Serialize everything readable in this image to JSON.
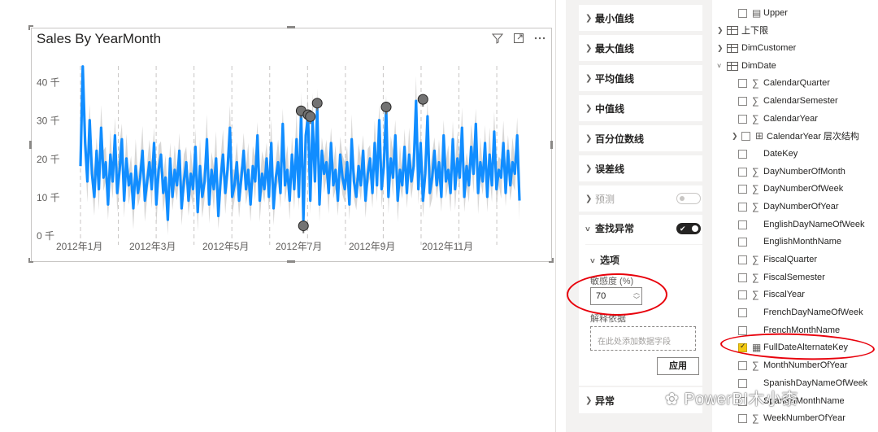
{
  "visual": {
    "title": "Sales By YearMonth",
    "header_icons": [
      "filter-icon",
      "focus-mode-icon",
      "more-options-icon"
    ]
  },
  "chart_data": {
    "type": "line",
    "title": "Sales By YearMonth",
    "xlabel": "",
    "ylabel": "",
    "y_ticks": [
      "0 千",
      "10 千",
      "20 千",
      "30 千",
      "40 千"
    ],
    "x_ticks": [
      "2012年1月",
      "2012年3月",
      "2012年5月",
      "2012年7月",
      "2012年9月",
      "2012年11月"
    ],
    "ylim": [
      0,
      45000
    ],
    "series_color": "#118dff",
    "band_color": "#c8c6c4",
    "anomaly_color": "#737373",
    "values": [
      18000,
      44000,
      24000,
      14000,
      30000,
      16000,
      10000,
      22000,
      12000,
      28000,
      15000,
      19000,
      8000,
      21000,
      14000,
      26000,
      11000,
      17000,
      25000,
      9000,
      20000,
      13000,
      16000,
      7000,
      18000,
      11000,
      15000,
      22000,
      9000,
      14000,
      19000,
      12000,
      24000,
      8000,
      17000,
      21000,
      11000,
      15000,
      4000,
      20000,
      10000,
      17000,
      13000,
      22000,
      7000,
      14000,
      19000,
      9000,
      16000,
      12000,
      23000,
      6000,
      18000,
      10000,
      14000,
      25000,
      8000,
      17000,
      12000,
      20000,
      5000,
      15000,
      21000,
      11000,
      17000,
      28000,
      10000,
      13000,
      19000,
      9000,
      15000,
      22000,
      12000,
      17000,
      8000,
      18000,
      14000,
      26000,
      9000,
      16000,
      12000,
      20000,
      10000,
      24000,
      7000,
      15000,
      19000,
      11000,
      29000,
      13000,
      17000,
      9000,
      21000,
      12000,
      25000,
      10000,
      32000,
      4000,
      26000,
      31000,
      9000,
      30000,
      14000,
      33000,
      8000,
      22000,
      16000,
      19000,
      11000,
      24000,
      13000,
      17000,
      9000,
      21000,
      15000,
      12000,
      19000,
      8000,
      25000,
      14000,
      10000,
      18000,
      13000,
      22000,
      9000,
      16000,
      20000,
      11000,
      24000,
      13000,
      30000,
      12000,
      18000,
      33000,
      10000,
      20000,
      15000,
      26000,
      9000,
      17000,
      13000,
      23000,
      11000,
      21000,
      14000,
      18000,
      35000,
      12000,
      24000,
      9000,
      16000,
      31000,
      11000,
      15000,
      22000,
      13000,
      19000,
      10000,
      26000,
      14000,
      17000,
      11000,
      25000,
      12000,
      20000,
      15000,
      28000,
      10000,
      18000,
      13000,
      23000,
      16000,
      29000,
      11000,
      19000,
      14000,
      24000,
      10000,
      21000,
      13000,
      27000,
      12000,
      17000,
      15000,
      24000,
      11000,
      22000,
      13000,
      19000,
      16000,
      26000,
      9000
    ],
    "anomalies": [
      {
        "index": 96,
        "value": 32000
      },
      {
        "index": 97,
        "value": 2000
      },
      {
        "index": 99,
        "value": 31000
      },
      {
        "index": 100,
        "value": 30500
      },
      {
        "index": 103,
        "value": 34000
      },
      {
        "index": 133,
        "value": 33000
      },
      {
        "index": 149,
        "value": 35000
      }
    ]
  },
  "format_pane": {
    "cards": [
      {
        "label": "最小值线"
      },
      {
        "label": "最大值线"
      },
      {
        "label": "平均值线"
      },
      {
        "label": "中值线"
      },
      {
        "label": "百分位数线"
      },
      {
        "label": "误差线"
      }
    ],
    "forecast": {
      "label": "预测",
      "toggle": "off"
    },
    "find_anomalies": {
      "label": "查找异常",
      "toggle": "on",
      "options": {
        "header": "选项",
        "sensitivity_label": "敏感度 (%)",
        "sensitivity_value": "70",
        "explain_label": "解释依据",
        "dropzone_placeholder": "在此处添加数据字段",
        "apply_label": "应用"
      }
    },
    "anomaly_card": {
      "label": "异常"
    },
    "annotation_color": "#e8000b"
  },
  "fields": {
    "items": [
      {
        "label": "Upper",
        "kind": "field",
        "checked": false
      },
      {
        "label": "上下限",
        "kind": "table"
      },
      {
        "label": "DimCustomer",
        "kind": "table"
      },
      {
        "label": "DimDate",
        "kind": "table-open"
      },
      {
        "label": "CalendarQuarter",
        "kind": "measure",
        "checked": false
      },
      {
        "label": "CalendarSemester",
        "kind": "measure",
        "checked": false
      },
      {
        "label": "CalendarYear",
        "kind": "measure",
        "checked": false
      },
      {
        "label": "CalendarYear 层次结构",
        "kind": "hierarchy",
        "checked": false
      },
      {
        "label": "DateKey",
        "kind": "field",
        "checked": false
      },
      {
        "label": "DayNumberOfMonth",
        "kind": "measure",
        "checked": false
      },
      {
        "label": "DayNumberOfWeek",
        "kind": "measure",
        "checked": false
      },
      {
        "label": "DayNumberOfYear",
        "kind": "measure",
        "checked": false
      },
      {
        "label": "EnglishDayNameOfWeek",
        "kind": "field",
        "checked": false
      },
      {
        "label": "EnglishMonthName",
        "kind": "field",
        "checked": false
      },
      {
        "label": "FiscalQuarter",
        "kind": "measure",
        "checked": false
      },
      {
        "label": "FiscalSemester",
        "kind": "measure",
        "checked": false
      },
      {
        "label": "FiscalYear",
        "kind": "measure",
        "checked": false
      },
      {
        "label": "FrenchDayNameOfWeek",
        "kind": "field",
        "checked": false
      },
      {
        "label": "FrenchMonthName",
        "kind": "field",
        "checked": false
      },
      {
        "label": "FullDateAlternateKey",
        "kind": "date",
        "checked": true
      },
      {
        "label": "MonthNumberOfYear",
        "kind": "measure",
        "checked": false
      },
      {
        "label": "SpanishDayNameOfWeek",
        "kind": "field",
        "checked": false
      },
      {
        "label": "SpanishMonthName",
        "kind": "field",
        "checked": false
      },
      {
        "label": "WeekNumberOfYear",
        "kind": "measure",
        "checked": false
      }
    ]
  },
  "watermark": "PowerBI木小桼"
}
